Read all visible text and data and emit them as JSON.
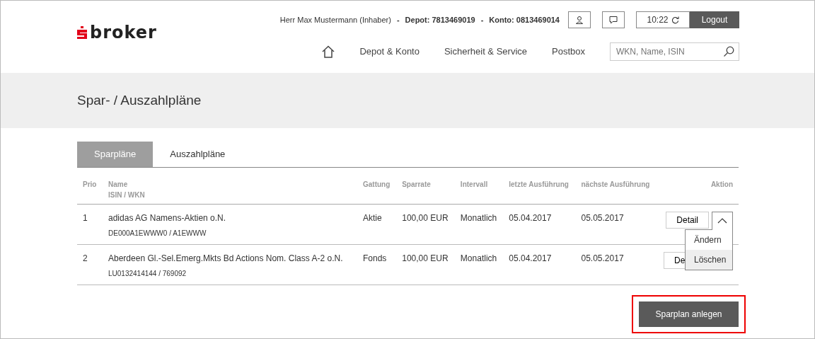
{
  "header": {
    "logo_text": "broker",
    "user": "Herr Max Mustermann (Inhaber)",
    "separator": "-",
    "depot": "Depot: 7813469019",
    "konto": "Konto: 0813469014",
    "time": "10:22",
    "logout": "Logout"
  },
  "nav": {
    "items": [
      "Depot & Konto",
      "Sicherheit & Service",
      "Postbox"
    ],
    "search": {
      "placeholder": "WKN, Name, ISIN"
    }
  },
  "page_title": "Spar- / Auszahlpläne",
  "tabs": [
    {
      "label": "Sparpläne",
      "selected": true
    },
    {
      "label": "Auszahlpläne",
      "selected": false
    }
  ],
  "table": {
    "columns": [
      {
        "label": "Prio"
      },
      {
        "label": "Name",
        "sub": "ISIN / WKN"
      },
      {
        "label": "Gattung"
      },
      {
        "label": "Sparrate"
      },
      {
        "label": "Intervall"
      },
      {
        "label": "letzte Ausführung"
      },
      {
        "label": "nächste Ausführung"
      },
      {
        "label": "Aktion"
      }
    ],
    "rows": [
      {
        "prio": "1",
        "name": "adidas AG Namens-Aktien o.N.",
        "isin": "DE000A1EWWW0 / A1EWWW",
        "gattung": "Aktie",
        "sparrate": "100,00 EUR",
        "intervall": "Monatlich",
        "letzte": "05.04.2017",
        "naechste": "05.05.2017",
        "detail": "Detail",
        "menu_expanded": true
      },
      {
        "prio": "2",
        "name": "Aberdeen Gl.-Sel.Emerg.Mkts Bd Actions Nom. Class A-2 o.N.",
        "isin": "LU0132414144 / 769092",
        "gattung": "Fonds",
        "sparrate": "100,00 EUR",
        "intervall": "Monatlich",
        "letzte": "05.04.2017",
        "naechste": "05.05.2017",
        "detail": "De",
        "menu_expanded": false
      }
    ]
  },
  "action_menu": [
    {
      "label": "Ändern",
      "selected": false
    },
    {
      "label": "Löschen",
      "selected": true
    }
  ],
  "create_button": {
    "label": "Sparplan anlegen",
    "highlighted": true
  }
}
